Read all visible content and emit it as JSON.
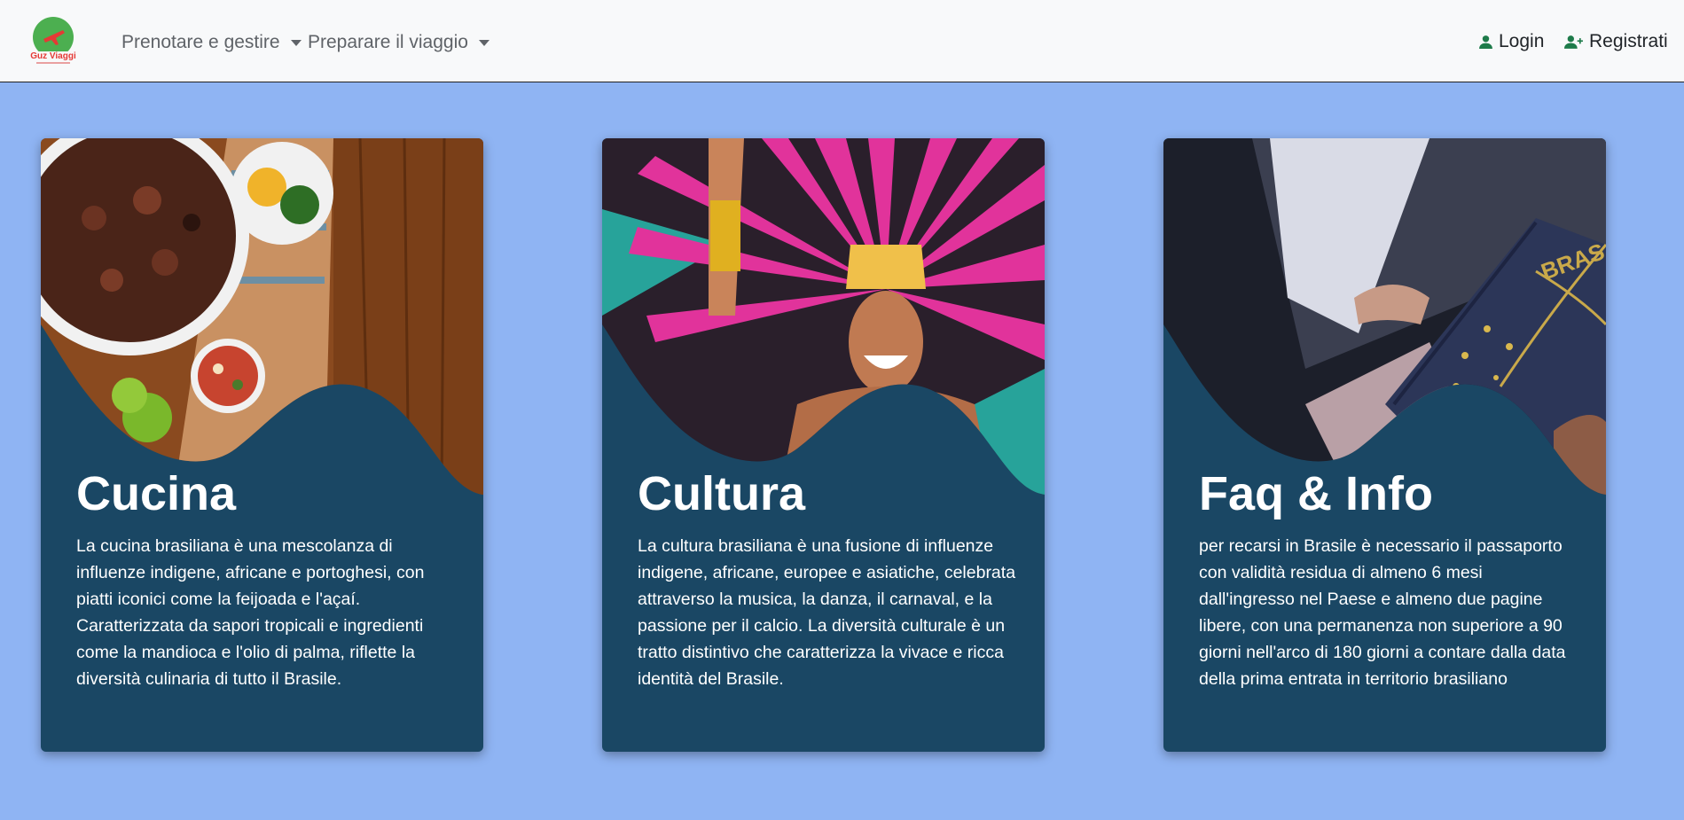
{
  "navbar": {
    "logo_text": "Guz Viaggi",
    "menus": [
      {
        "label": "Prenotare e gestire"
      },
      {
        "label": "Preparare il viaggio"
      }
    ],
    "login_label": "Login",
    "register_label": "Registrati"
  },
  "cards": [
    {
      "title": "Cucina",
      "text": "La cucina brasiliana è una mescolanza di influenze indigene, africane e portoghesi, con piatti iconici come la feijoada e l'açaí. Caratterizzata da sapori tropicali e ingredienti come la mandioca e l'olio di palma, riflette la diversità culinaria di tutto il Brasile."
    },
    {
      "title": "Cultura",
      "text": "La cultura brasiliana è una fusione di influenze indigene, africane, europee e asiatiche, celebrata attraverso la musica, la danza, il carnaval, e la passione per il calcio. La diversità culturale è un tratto distintivo che caratterizza la vivace e ricca identità del Brasile."
    },
    {
      "title": "Faq & Info",
      "text": "per recarsi in Brasile è necessario il passaporto con validità residua di almeno 6 mesi dall'ingresso nel Paese e almeno due pagine libere, con una permanenza non superiore a 90 giorni nell'arco di 180 giorni a contare dalla data della prima entrata in territorio brasiliano"
    }
  ],
  "colors": {
    "page_background": "#8fb4f3",
    "navbar_background": "#f8f9fa",
    "card_background": "#1a4764",
    "auth_icon": "#1e7b4a",
    "logo_green": "#4caf50",
    "logo_red": "#e53935"
  }
}
